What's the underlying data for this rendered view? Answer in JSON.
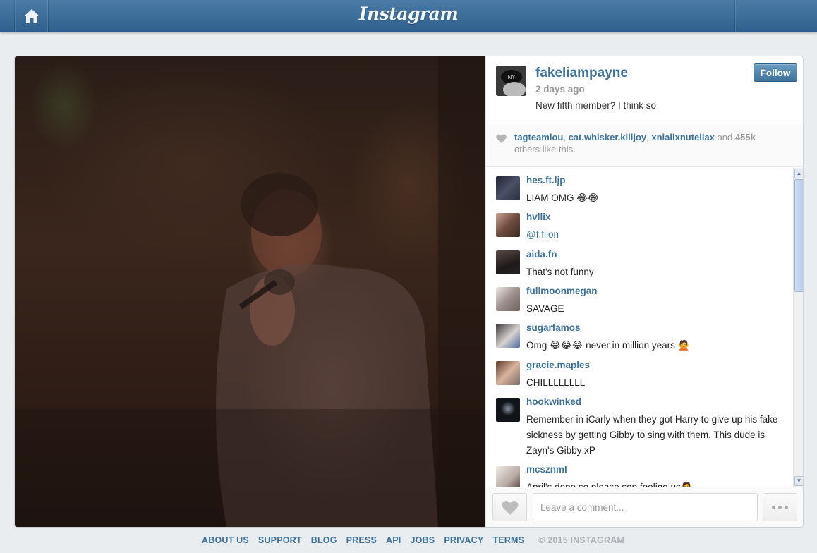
{
  "topbar": {
    "logo": "Instagram"
  },
  "post": {
    "username": "fakeliampayne",
    "time": "2 days ago",
    "caption": "New fifth member? I think so",
    "follow_label": "Follow"
  },
  "likes": {
    "users": [
      "tagteamlou",
      "cat.whisker.killjoy",
      "xniallxnutellax"
    ],
    "sep1": ", ",
    "sep2": ", ",
    "and_word": " and ",
    "count": "455k",
    "suffix": "others like this."
  },
  "comments": [
    {
      "user": "hes.ft.ljp",
      "text": "LIAM OMG 😂😂",
      "avatar_color": "#2b3140"
    },
    {
      "user": "hvllix",
      "text": "@f.fiion",
      "avatar_color": "#8a6b5c",
      "mention": true
    },
    {
      "user": "aida.fn",
      "text": "That's not funny",
      "avatar_color": "#2a2424"
    },
    {
      "user": "fullmoonmegan",
      "text": "SAVAGE",
      "avatar_color": "#b5aba8"
    },
    {
      "user": "sugarfamos",
      "text": "Omg 😂😂😂 never in million years 🙅",
      "avatar_color": "#6f6a66"
    },
    {
      "user": "gracie.maples",
      "text": "CHILLLLLLLL",
      "avatar_color": "#9a7a6a"
    },
    {
      "user": "hookwinked",
      "text": "Remember in iCarly when they got Harry to give up his fake sickness by getting Gibby to sing with them. This dude is Zayn's Gibby xP",
      "avatar_color": "#111418"
    },
    {
      "user": "mcsznml",
      "text": "April's done so please sop fooling us🙅",
      "avatar_color": "#d9d3cf"
    }
  ],
  "comment_box": {
    "placeholder": "Leave a comment..."
  },
  "footer": {
    "links": [
      "ABOUT US",
      "SUPPORT",
      "BLOG",
      "PRESS",
      "API",
      "JOBS",
      "PRIVACY",
      "TERMS"
    ],
    "copyright": "© 2015 INSTAGRAM"
  },
  "colors": {
    "brand_blue": "#3f729b",
    "topbar": "#3a6a96",
    "background": "#e9edf0"
  },
  "icons": [
    "home-icon",
    "heart-icon",
    "more-icon",
    "scroll-up-icon",
    "scroll-down-icon"
  ]
}
